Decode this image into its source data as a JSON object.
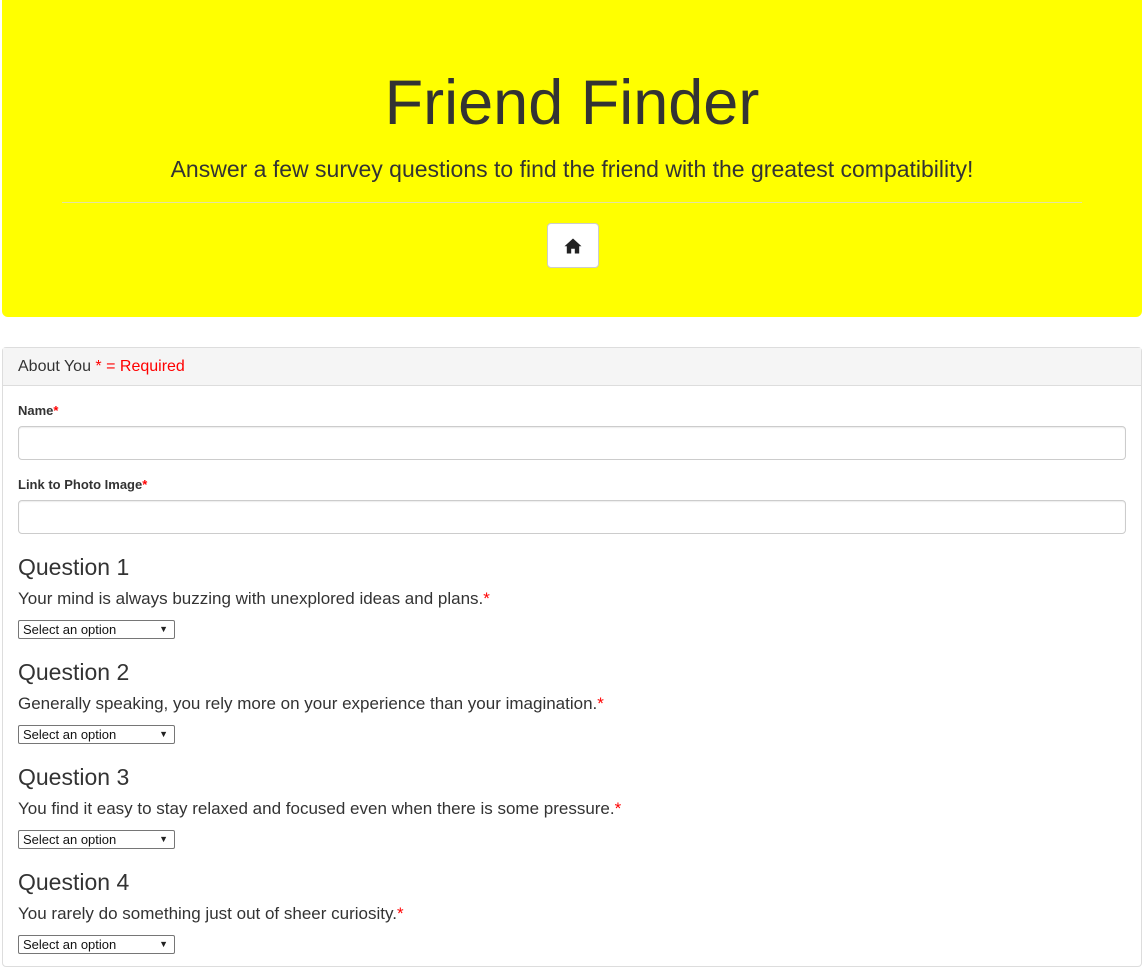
{
  "header": {
    "title": "Friend Finder",
    "lead": "Answer a few survey questions to find the friend with the greatest compatibility!",
    "home_icon": "home-icon",
    "background_color": "#ffff00"
  },
  "panel": {
    "heading": "About You",
    "required_note": "* = Required"
  },
  "fields": {
    "name_label": "Name",
    "name_required": "*",
    "name_value": "",
    "photo_label": "Link to Photo Image",
    "photo_required": "*",
    "photo_value": ""
  },
  "questions": [
    {
      "title": "Question 1",
      "text": "Your mind is always buzzing with unexplored ideas and plans.",
      "required": "*",
      "selected": "Select an option"
    },
    {
      "title": "Question 2",
      "text": "Generally speaking, you rely more on your experience than your imagination.",
      "required": "*",
      "selected": "Select an option"
    },
    {
      "title": "Question 3",
      "text": "You find it easy to stay relaxed and focused even when there is some pressure.",
      "required": "*",
      "selected": "Select an option"
    },
    {
      "title": "Question 4",
      "text": "You rarely do something just out of sheer curiosity.",
      "required": "*",
      "selected": "Select an option"
    }
  ],
  "colors": {
    "required": "#ff0000",
    "text": "#333333"
  }
}
